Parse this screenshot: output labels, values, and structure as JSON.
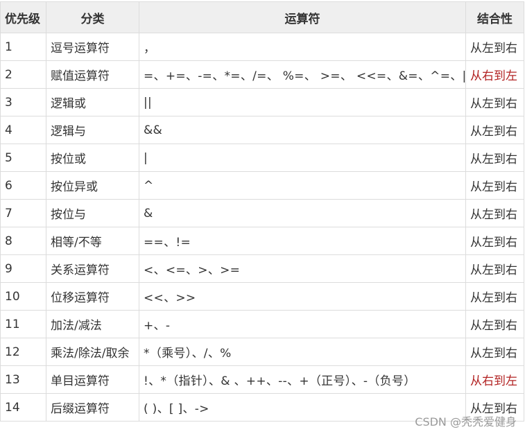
{
  "table": {
    "headers": {
      "level": "优先级",
      "category": "分类",
      "operators": "运算符",
      "associativity": "结合性"
    },
    "rows": [
      {
        "level": "1",
        "category": "逗号运算符",
        "operators": "，",
        "associativity": "从左到右",
        "rtl": false
      },
      {
        "level": "2",
        "category": "赋值运算符",
        "operators": "=、+=、-=、*=、/=、 %=、 >=、 <<=、&=、^=、|=",
        "associativity": "从右到左",
        "rtl": true
      },
      {
        "level": "3",
        "category": "逻辑或",
        "operators": "||",
        "associativity": "从左到右",
        "rtl": false
      },
      {
        "level": "4",
        "category": "逻辑与",
        "operators": "&&",
        "associativity": "从左到右",
        "rtl": false
      },
      {
        "level": "5",
        "category": "按位或",
        "operators": "|",
        "associativity": "从左到右",
        "rtl": false
      },
      {
        "level": "6",
        "category": "按位异或",
        "operators": "^",
        "associativity": "从左到右",
        "rtl": false
      },
      {
        "level": "7",
        "category": "按位与",
        "operators": "&",
        "associativity": "从左到右",
        "rtl": false
      },
      {
        "level": "8",
        "category": "相等/不等",
        "operators": "==、!=",
        "associativity": "从左到右",
        "rtl": false
      },
      {
        "level": "9",
        "category": "关系运算符",
        "operators": "<、<=、>、>=",
        "associativity": "从左到右",
        "rtl": false
      },
      {
        "level": "10",
        "category": "位移运算符",
        "operators": "<<、>>",
        "associativity": "从左到右",
        "rtl": false
      },
      {
        "level": "11",
        "category": "加法/减法",
        "operators": "+、-",
        "associativity": "从左到右",
        "rtl": false
      },
      {
        "level": "12",
        "category": "乘法/除法/取余",
        "operators": "*（乘号）、/、%",
        "associativity": "从左到右",
        "rtl": false
      },
      {
        "level": "13",
        "category": "单目运算符",
        "operators": "!、*（指针）、& 、++、--、+（正号）、-（负号）",
        "associativity": "从右到左",
        "rtl": true
      },
      {
        "level": "14",
        "category": "后缀运算符",
        "operators": "( )、[ ]、->",
        "associativity": "从左到右",
        "rtl": false
      }
    ]
  },
  "watermark": "CSDN @秃秃爱健身",
  "colors": {
    "header_bg": "#efefef",
    "border": "#dcdcdc",
    "rtl_text": "#b22222"
  }
}
